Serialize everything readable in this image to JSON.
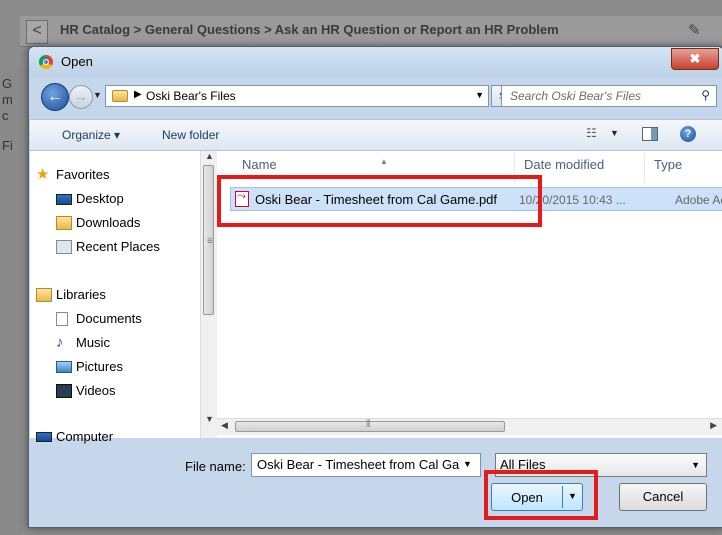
{
  "background_page": {
    "back_glyph": "<",
    "breadcrumb": "HR Catalog > General Questions > Ask an HR Question or Report an HR Problem",
    "attach_icon": "paperclip-icon",
    "side_glyphs": [
      "G",
      "m",
      "c",
      "Fi"
    ]
  },
  "dialog": {
    "title": "Open",
    "close_label": "✖",
    "address": {
      "crumb": "Oski Bear's Files",
      "search_placeholder": "Search Oski Bear's Files"
    },
    "toolbar": {
      "organize": "Organize ▾",
      "new_folder": "New folder"
    },
    "nav": {
      "favorites": "Favorites",
      "favorites_items": [
        "Desktop",
        "Downloads",
        "Recent Places"
      ],
      "libraries": "Libraries",
      "libraries_items": [
        "Documents",
        "Music",
        "Pictures",
        "Videos"
      ],
      "computer": "Computer"
    },
    "columns": {
      "name": "Name",
      "date_modified": "Date modified",
      "type": "Type"
    },
    "files": [
      {
        "name": "Oski Bear - Timesheet from Cal Game.pdf",
        "date": "10/20/2015 10:43 ...",
        "type": "Adobe Ac"
      }
    ],
    "footer": {
      "file_name_label": "File name:",
      "file_name_value": "Oski Bear - Timesheet from Cal Ga",
      "file_type": "All Files",
      "open_label": "Open",
      "cancel_label": "Cancel"
    }
  },
  "colors": {
    "highlight": "#e31b1b",
    "selection": "#cde2f8",
    "dialog_frame": "#c6d7eb"
  }
}
